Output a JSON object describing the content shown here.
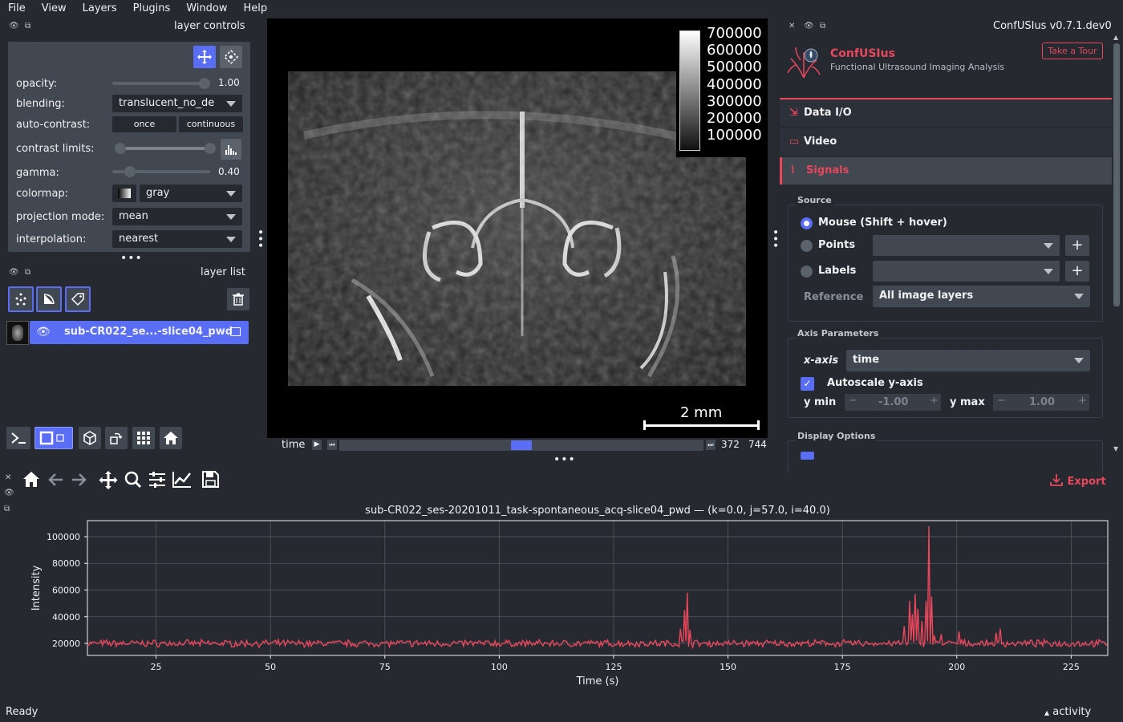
{
  "menu": [
    "File",
    "View",
    "Layers",
    "Plugins",
    "Window",
    "Help"
  ],
  "layer_controls": {
    "title": "layer controls",
    "opacity_label": "opacity:",
    "opacity_value": "1.00",
    "blending_label": "blending:",
    "blending_value": "translucent_no_de",
    "auto_contrast_label": "auto-contrast:",
    "once_label": "once",
    "continuous_label": "continuous",
    "contrast_label": "contrast limits:",
    "gamma_label": "gamma:",
    "gamma_value": "0.40",
    "colormap_label": "colormap:",
    "colormap_value": "gray",
    "projection_label": "projection mode:",
    "projection_value": "mean",
    "interpolation_label": "interpolation:",
    "interpolation_value": "nearest",
    "opacity_fraction": 1.0,
    "gamma_fraction": 0.1
  },
  "layer_list": {
    "title": "layer list",
    "layer_name": "sub-CR022_se...-slice04_pwd"
  },
  "canvas": {
    "colorbar_ticks": [
      "700000",
      "600000",
      "500000",
      "400000",
      "300000",
      "200000",
      "100000"
    ],
    "scale_bar": "2 mm",
    "time_label": "time",
    "time_value": "372",
    "time_max": "744",
    "time_fraction": 0.5
  },
  "plugin": {
    "title": "ConfUSIus v0.7.1.dev0",
    "name": "ConfUSIus",
    "subtitle": "Functional Ultrasound Imaging Analysis",
    "tour_button": "Take a Tour",
    "nav": [
      "Data I/O",
      "Video",
      "Signals"
    ],
    "source_title": "Source",
    "mouse_option": "Mouse (Shift + hover)",
    "points_option": "Points",
    "labels_option": "Labels",
    "reference_label": "Reference",
    "reference_value": "All image layers",
    "axis_title": "Axis Parameters",
    "xaxis_label": "x-axis",
    "xaxis_value": "time",
    "autoscale_label": "Autoscale y-axis",
    "ymin_label": "y min",
    "ymin_value": "-1.00",
    "ymax_label": "y max",
    "ymax_value": "1.00",
    "display_title": "Display Options"
  },
  "plot_toolbar": {
    "export_label": "Export"
  },
  "chart_data": {
    "type": "line",
    "title": "sub-CR022_ses-20201011_task-spontaneous_acq-slice04_pwd — (k=0.0, j=57.0, i=40.0)",
    "xlabel": "Time (s)",
    "ylabel": "Intensity",
    "xlim": [
      10,
      233
    ],
    "ylim": [
      11000,
      112000
    ],
    "xticks": [
      25,
      50,
      75,
      100,
      125,
      150,
      175,
      200,
      225
    ],
    "yticks": [
      20000,
      40000,
      60000,
      80000,
      100000
    ],
    "ytick_labels": [
      "20000",
      "40000",
      "60000",
      "80000",
      "100000"
    ],
    "grid": true,
    "color": "#e8475c",
    "baseline": 20000,
    "peaks": [
      {
        "x": 139.5,
        "y": 31000
      },
      {
        "x": 140.4,
        "y": 45000
      },
      {
        "x": 141.0,
        "y": 58000
      },
      {
        "x": 141.6,
        "y": 30000
      },
      {
        "x": 188.5,
        "y": 33000
      },
      {
        "x": 189.6,
        "y": 52000
      },
      {
        "x": 190.4,
        "y": 42000
      },
      {
        "x": 191.0,
        "y": 57000
      },
      {
        "x": 191.6,
        "y": 46000
      },
      {
        "x": 192.3,
        "y": 37000
      },
      {
        "x": 193.3,
        "y": 52000
      },
      {
        "x": 193.9,
        "y": 108000
      },
      {
        "x": 194.4,
        "y": 55000
      },
      {
        "x": 195.2,
        "y": 26000
      },
      {
        "x": 196.5,
        "y": 27000
      },
      {
        "x": 200.5,
        "y": 29000
      },
      {
        "x": 208.5,
        "y": 28000
      },
      {
        "x": 209.5,
        "y": 31000
      }
    ]
  },
  "status": {
    "ready": "Ready",
    "activity": "activity"
  }
}
